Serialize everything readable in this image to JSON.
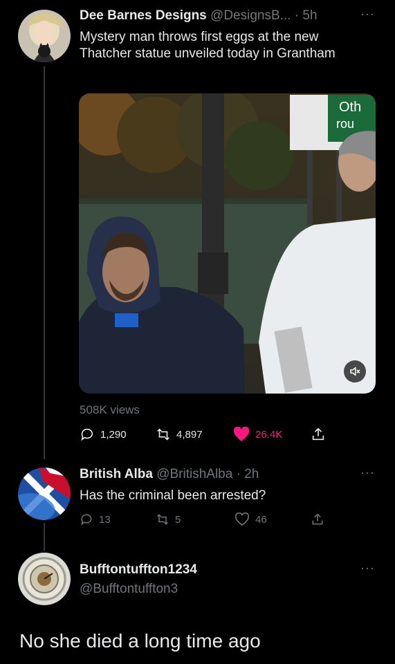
{
  "tweet": {
    "author_name": "Dee Barnes Designs",
    "author_handle": "@DesignsB...",
    "time": "· 5h",
    "text": "Mystery man throws first eggs at the new Thatcher statue unveiled today in Grantham",
    "views": "508K views",
    "replies": "1,290",
    "retweets": "4,897",
    "likes": "26.4K",
    "liked": true,
    "sign_text_line1": "Oth",
    "sign_text_line2": "rou"
  },
  "reply1": {
    "author_name": "British Alba",
    "author_handle": "@BritishAlba",
    "time": "· 2h",
    "text": "Has the criminal been arrested?",
    "replies": "13",
    "retweets": "5",
    "likes": "46"
  },
  "reply2": {
    "author_name": "Bufftontuffton1234",
    "author_handle": "@Bufftontuffton3",
    "text": "No she died a long time ago"
  },
  "more_label": "···",
  "colors": {
    "like_active": "#f91880",
    "muted_text": "#71767b",
    "text": "#e7e9ea",
    "background": "#000000"
  },
  "icons": [
    "reply-icon",
    "retweet-icon",
    "heart-icon",
    "share-icon",
    "more-icon",
    "mute-icon"
  ]
}
